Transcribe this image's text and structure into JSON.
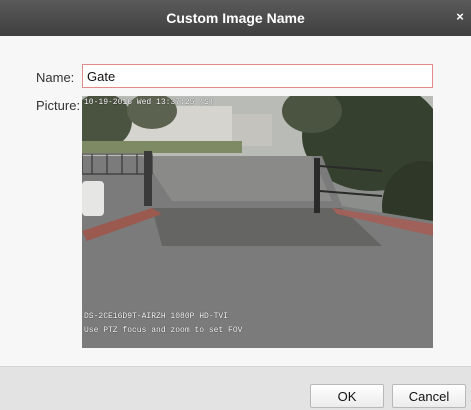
{
  "dialog": {
    "title": "Custom Image Name",
    "close_glyph": "×"
  },
  "form": {
    "name_label": "Name:",
    "name_value": "Gate",
    "picture_label": "Picture:"
  },
  "picture": {
    "timestamp": "10-19-2016 Wed 13:37:25 (S)",
    "camera_model": "DS-2CE16D9T-AIRZH  1080P HD-TVI",
    "hint": "Use PTZ focus and zoom to set FOV"
  },
  "buttons": {
    "ok": "OK",
    "cancel": "Cancel"
  },
  "colors": {
    "titlebar": "#474747",
    "input_border": "#e38a8a"
  }
}
